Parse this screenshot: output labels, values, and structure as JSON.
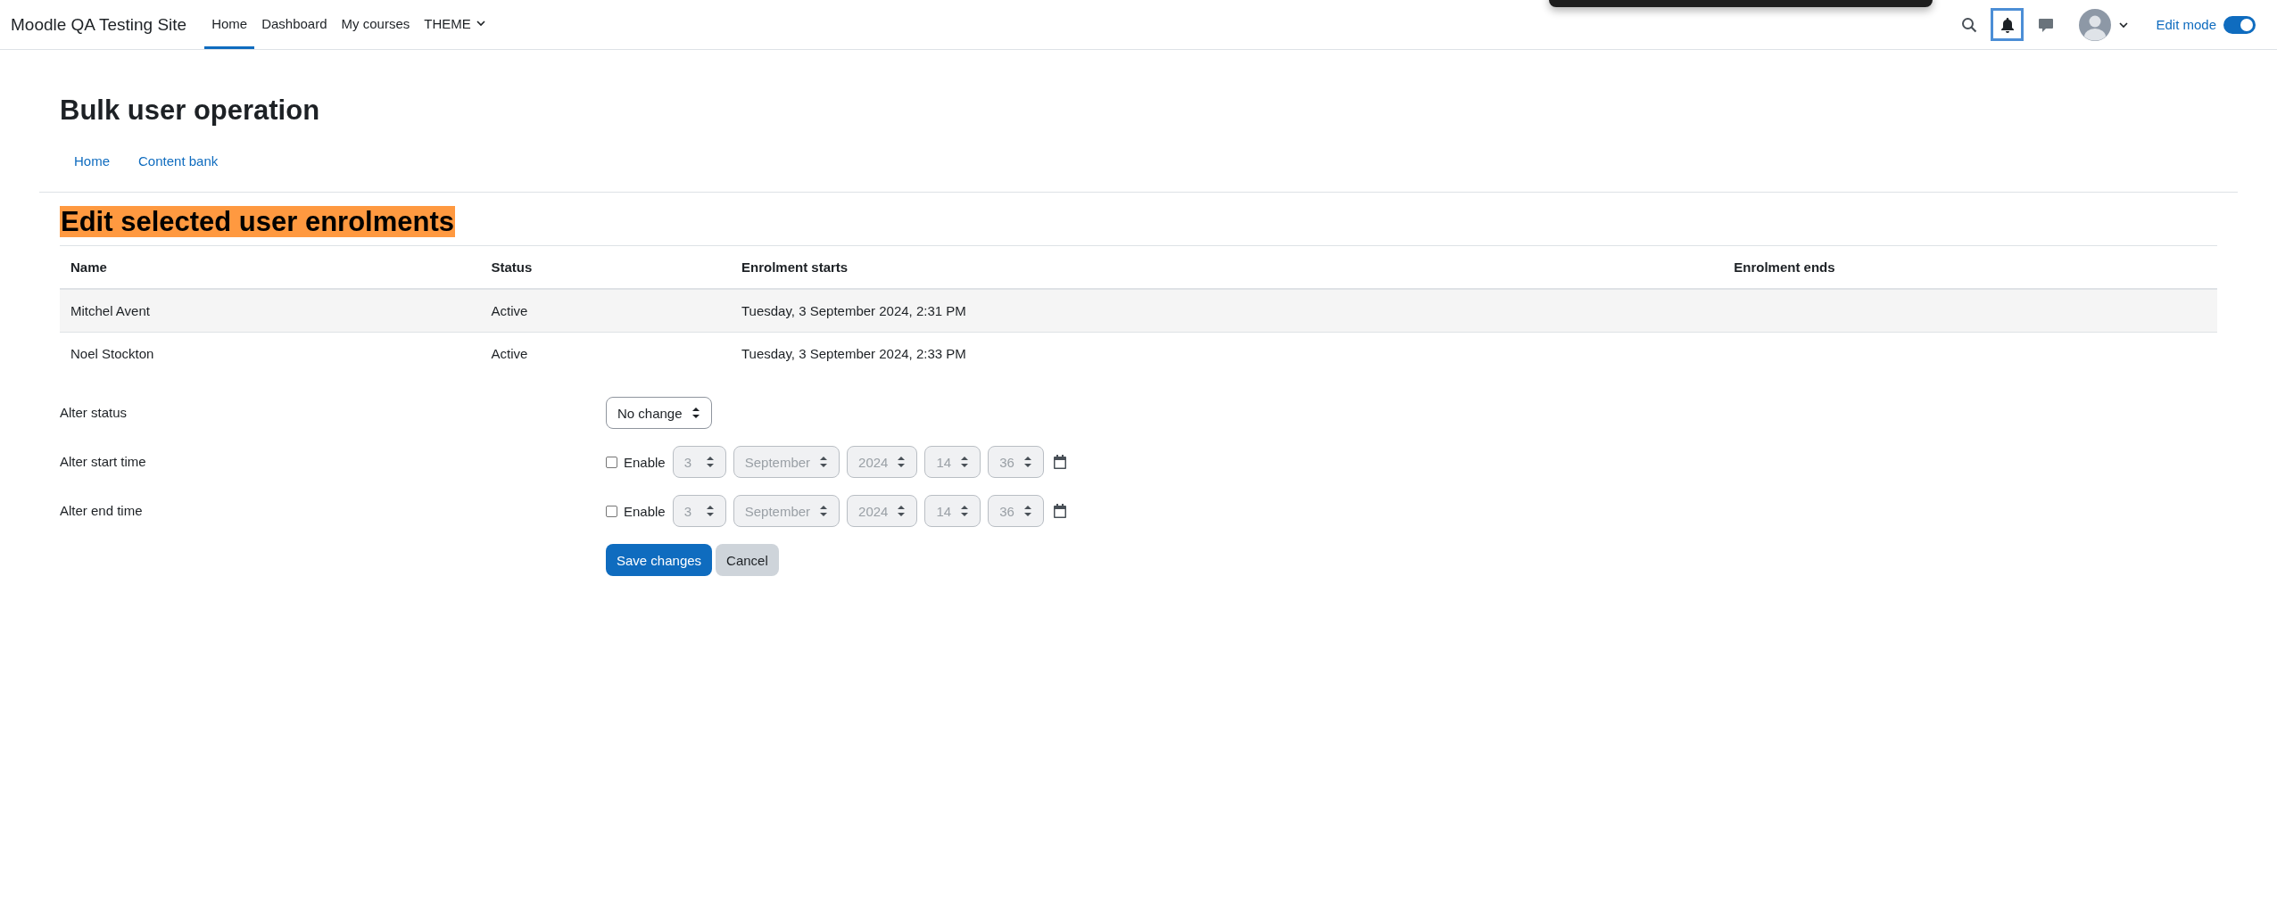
{
  "navbar": {
    "site_name": "Moodle QA Testing Site",
    "nav_items": [
      {
        "label": "Home",
        "selected": true,
        "dropdown": false
      },
      {
        "label": "Dashboard",
        "selected": false,
        "dropdown": false
      },
      {
        "label": "My courses",
        "selected": false,
        "dropdown": false
      },
      {
        "label": "THEME",
        "selected": false,
        "dropdown": true
      }
    ],
    "notifications": {
      "focused": true
    },
    "edit_mode": {
      "label": "Edit mode",
      "on": true
    }
  },
  "page_title": "Bulk user operation",
  "secondary_nav": [
    "Home",
    "Content bank"
  ],
  "section_title": "Edit selected user enrolments",
  "table": {
    "columns": [
      "Name",
      "Status",
      "Enrolment starts",
      "Enrolment ends"
    ],
    "rows": [
      [
        "Mitchel Avent",
        "Active",
        "Tuesday, 3 September 2024, 2:31 PM"
      ],
      [
        "Noel Stockton",
        "Active",
        "Tuesday, 3 September 2024, 2:33 PM"
      ]
    ]
  },
  "form": {
    "rows": [
      {
        "kind": "select",
        "label": "Alter status",
        "value": "No change"
      },
      {
        "kind": "datetime",
        "label": "Alter start time",
        "enable_label": "Enable",
        "checked": false,
        "day": "3",
        "month": "September",
        "year": "2024",
        "hour": "14",
        "minute": "36"
      },
      {
        "kind": "datetime",
        "label": "Alter end time",
        "enable_label": "Enable",
        "checked": false,
        "day": "3",
        "month": "September",
        "year": "2024",
        "hour": "14",
        "minute": "36"
      }
    ],
    "buttons": [
      {
        "label": "Save changes",
        "kind": "primary"
      },
      {
        "label": "Cancel",
        "kind": "secondary"
      }
    ]
  }
}
